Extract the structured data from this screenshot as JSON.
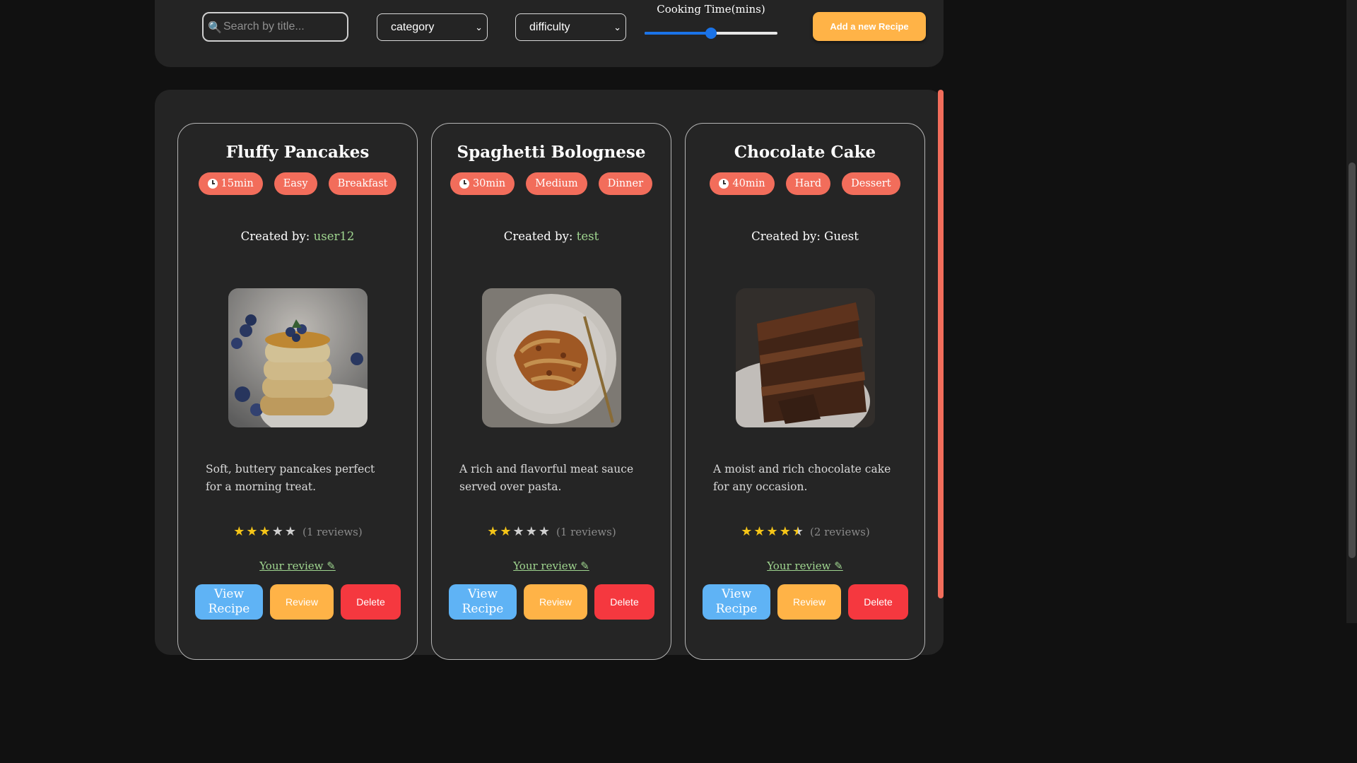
{
  "filters": {
    "search_placeholder": "Search by title...",
    "category_label": "category",
    "difficulty_label": "difficulty",
    "cooking_time_label": "Cooking Time(mins)",
    "cooking_time_fraction": 0.5,
    "add_button": "Add a new Recipe"
  },
  "colors": {
    "accent": "#f26d5b",
    "username": "#9fd58f",
    "view": "#5fb3f5",
    "review": "#ffb347",
    "delete": "#f5383f",
    "star": "#f5c518"
  },
  "cards": [
    {
      "title": "Fluffy Pancakes",
      "time": "15min",
      "difficulty": "Easy",
      "category": "Breakfast",
      "created_prefix": "Created by: ",
      "author": "user12",
      "description": "Soft, buttery pancakes perfect for a morning treat.",
      "rating": 3,
      "reviews": "(1 reviews)",
      "your_review": "Your review ✎",
      "view_label": "View Recipe",
      "review_label": "Review",
      "delete_label": "Delete"
    },
    {
      "title": "Spaghetti Bolognese",
      "time": "30min",
      "difficulty": "Medium",
      "category": "Dinner",
      "created_prefix": "Created by: ",
      "author": "test",
      "description": "A rich and flavorful meat sauce served over pasta.",
      "rating": 2,
      "reviews": "(1 reviews)",
      "your_review": "Your review ✎",
      "view_label": "View Recipe",
      "review_label": "Review",
      "delete_label": "Delete"
    },
    {
      "title": "Chocolate Cake",
      "time": "40min",
      "difficulty": "Hard",
      "category": "Dessert",
      "created_prefix": "Created by: ",
      "author": "Guest",
      "description": "A moist and rich chocolate cake for any occasion.",
      "rating": 4.5,
      "reviews": "(2 reviews)",
      "your_review": "Your review ✎",
      "view_label": "View Recipe",
      "review_label": "Review",
      "delete_label": "Delete"
    }
  ]
}
